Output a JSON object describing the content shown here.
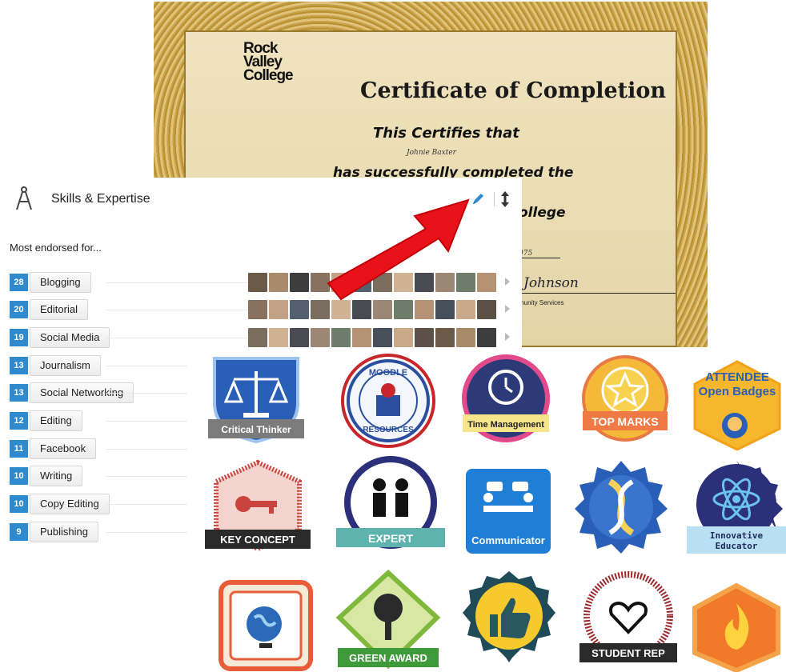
{
  "certificate": {
    "logo_lines": [
      "Rock",
      "Valley",
      "College"
    ],
    "title": "Certificate of Completion",
    "certifies": "This Certifies that",
    "recipient": "Johnie Baxter",
    "completed": "has successfully completed the",
    "college_fragment": "ollege",
    "year_fragment": "075",
    "signature": "Johnson",
    "services_fragment": "munity Services"
  },
  "skills": {
    "title": "Skills & Expertise",
    "subtitle": "Most endorsed for...",
    "items": [
      {
        "count": "28",
        "label": "Blogging"
      },
      {
        "count": "20",
        "label": "Editorial"
      },
      {
        "count": "19",
        "label": "Social Media"
      },
      {
        "count": "13",
        "label": "Journalism"
      },
      {
        "count": "13",
        "label": "Social Networking"
      },
      {
        "count": "12",
        "label": "Editing"
      },
      {
        "count": "11",
        "label": "Facebook"
      },
      {
        "count": "10",
        "label": "Writing"
      },
      {
        "count": "10",
        "label": "Copy Editing"
      },
      {
        "count": "9",
        "label": "Publishing"
      }
    ],
    "icons": {
      "skills": "compass-icon",
      "edit": "pencil-icon",
      "reorder": "up-down-arrow-icon"
    },
    "accent": "#2e8bd0"
  },
  "badges": {
    "critical_thinker": "Critical Thinker",
    "moodle_top": "MOODLE",
    "moodle_bottom": "RESOURCES",
    "time_management": "Time Management",
    "top_marks": "TOP MARKS",
    "attendee_line1": "ATTENDEE",
    "attendee_line2": "Open Badges",
    "key_concept": "KEY CONCEPT",
    "expert": "EXPERT",
    "communicator": "Communicator",
    "innovative_line1": "Innovative",
    "innovative_line2": "Educator",
    "green_award": "GREEN AWARD",
    "student_rep": "STUDENT REP"
  }
}
